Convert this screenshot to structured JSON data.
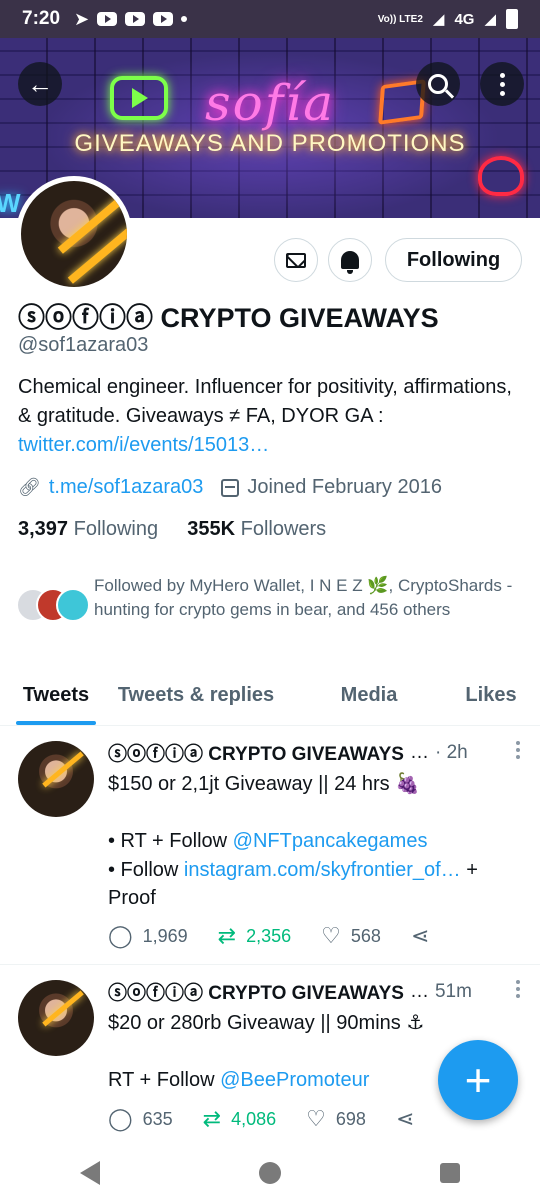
{
  "status_bar": {
    "time": "7:20",
    "network": "Vo)) LTE2",
    "signal": "4G"
  },
  "banner": {
    "title": "sofía",
    "subtitle": "GIVEAWAYS AND PROMOTIONS",
    "edge_text": "W"
  },
  "profile": {
    "display_name": "ⓢⓞⓕⓘⓐ CRYPTO GIVEAWAYS",
    "handle": "@sof1azara03",
    "bio_text": "Chemical engineer. Influencer for positivity, affirmations, & gratitude. Giveaways ≠ FA, DYOR GA : ",
    "bio_link": "twitter.com/i/events/15013…",
    "website": "t.me/sof1azara03",
    "joined": "Joined February 2016",
    "following_count": "3,397",
    "following_label": "Following",
    "followers_count": "355K",
    "followers_label": "Followers",
    "followed_by": "Followed by MyHero Wallet, I N E Z 🌿, CryptoShards - hunting for crypto gems in bear, and 456 others",
    "following_button": "Following"
  },
  "tabs": [
    {
      "label": "Tweets"
    },
    {
      "label": "Tweets & replies"
    },
    {
      "label": "Media"
    },
    {
      "label": "Likes"
    }
  ],
  "tweets": [
    {
      "name": "ⓢⓞⓕⓘⓐ CRYPTO GIVEAWAYS",
      "ellipsis": "…",
      "time": "· 2h",
      "line1": "$150 or 2,1jt Giveaway || 24 hrs 🍇",
      "line2_prefix": "• RT + Follow ",
      "line2_link": "@NFTpancakegames",
      "line3_prefix": "• Follow ",
      "line3_link": "instagram.com/skyfrontier_of…",
      "line3_suffix": " + Proof",
      "replies": "1,969",
      "retweets": "2,356",
      "likes": "568"
    },
    {
      "name": "ⓢⓞⓕⓘⓐ CRYPTO GIVEAWAYS",
      "ellipsis": "…",
      "time": "51m",
      "line1": "$20 or 280rb Giveaway || 90mins ⚓",
      "line2_prefix": "RT + Follow ",
      "line2_link": "@BeePromoteur",
      "replies": "635",
      "retweets": "4,086",
      "likes": "698"
    }
  ],
  "fab": {
    "label": "+"
  },
  "colors": {
    "accent": "#1d9bf0",
    "retweet": "#00ba7c",
    "secondary_text": "#536471"
  }
}
